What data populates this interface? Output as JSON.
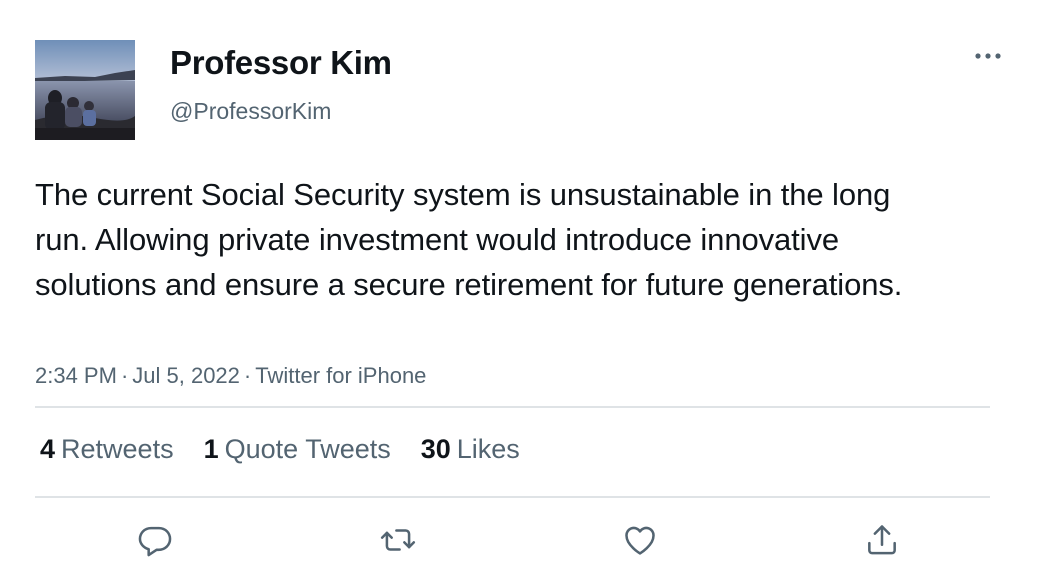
{
  "author": {
    "display_name": "Professor Kim",
    "handle": "@ProfessorKim"
  },
  "tweet": {
    "text": "The current Social Security system is unsustainable in the long run. Allowing private investment would introduce innovative solutions and ensure a secure retirement for future generations.",
    "time": "2:34 PM",
    "date": "Jul 5, 2022",
    "source": "Twitter for iPhone",
    "separator": "·"
  },
  "stats": {
    "retweets_count": "4",
    "retweets_label": "Retweets",
    "quotes_count": "1",
    "quotes_label": "Quote Tweets",
    "likes_count": "30",
    "likes_label": "Likes"
  },
  "icons": {
    "more": "more-horizontal-icon",
    "reply": "reply-icon",
    "retweet": "retweet-icon",
    "like": "heart-icon",
    "share": "share-icon"
  },
  "colors": {
    "text_primary": "#0f1419",
    "text_secondary": "#536471",
    "divider": "#dfe3e6"
  }
}
